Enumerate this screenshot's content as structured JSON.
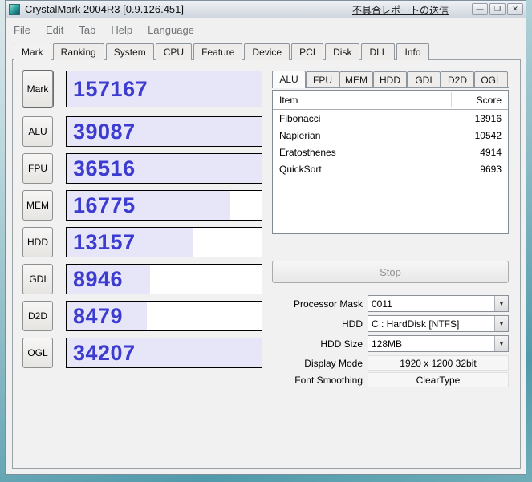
{
  "window": {
    "title": "CrystalMark 2004R3 [0.9.126.451]",
    "report_link": "不具合レポートの送信",
    "controls": {
      "minimize": "—",
      "maximize": "❐",
      "close": "✕"
    }
  },
  "menu": {
    "items": [
      "File",
      "Edit",
      "Tab",
      "Help",
      "Language"
    ]
  },
  "main_tabs": {
    "active": "Mark",
    "items": [
      "Mark",
      "Ranking",
      "System",
      "CPU",
      "Feature",
      "Device",
      "PCI",
      "Disk",
      "DLL",
      "Info"
    ]
  },
  "benchmarks": [
    {
      "label": "Mark",
      "score": "157167",
      "fill_pct": 100
    },
    {
      "label": "ALU",
      "score": "39087",
      "fill_pct": 100
    },
    {
      "label": "FPU",
      "score": "36516",
      "fill_pct": 100
    },
    {
      "label": "MEM",
      "score": "16775",
      "fill_pct": 84
    },
    {
      "label": "HDD",
      "score": "13157",
      "fill_pct": 65
    },
    {
      "label": "GDI",
      "score": "8946",
      "fill_pct": 43
    },
    {
      "label": "D2D",
      "score": "8479",
      "fill_pct": 41
    },
    {
      "label": "OGL",
      "score": "34207",
      "fill_pct": 100
    }
  ],
  "detail": {
    "active_tab": "ALU",
    "tabs": [
      "ALU",
      "FPU",
      "MEM",
      "HDD",
      "GDI",
      "D2D",
      "OGL"
    ],
    "table": {
      "headers": [
        "Item",
        "Score"
      ],
      "rows": [
        {
          "item": "Fibonacci",
          "score": "13916"
        },
        {
          "item": "Napierian",
          "score": "10542"
        },
        {
          "item": "Eratosthenes",
          "score": "4914"
        },
        {
          "item": "QuickSort",
          "score": "9693"
        }
      ]
    },
    "stop_label": "Stop"
  },
  "settings": [
    {
      "label": "Processor Mask",
      "value": "0011"
    },
    {
      "label": "HDD",
      "value": "C : HardDisk [NTFS]"
    },
    {
      "label": "HDD Size",
      "value": "128MB"
    },
    {
      "label": "Display Mode",
      "value": "1920 x 1200 32bit"
    },
    {
      "label": "Font Smoothing",
      "value": "ClearType"
    }
  ],
  "colors": {
    "score_text": "#3c3cd0",
    "bar_fill": "#e7e5f8"
  }
}
